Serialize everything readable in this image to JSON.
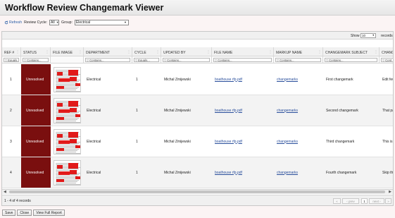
{
  "title": "Workflow Review Changemark Viewer",
  "toolbar": {
    "refresh_label": "Refresh",
    "review_cycle_label": "Review Cycle:",
    "review_cycle_value": "All",
    "group_label": "Group:",
    "group_value": "Electrical"
  },
  "pager_top": {
    "show_label": "Show",
    "show_value": "10",
    "records_label": "records"
  },
  "columns": [
    {
      "label": "REF #",
      "filter": "Equals..."
    },
    {
      "label": "STATUS",
      "filter": "Contains..."
    },
    {
      "label": "FILE IMAGE",
      "filter": ""
    },
    {
      "label": "DEPARTMENT",
      "filter": "Contains..."
    },
    {
      "label": "CYCLE",
      "filter": "Equals..."
    },
    {
      "label": "UPDATED BY",
      "filter": "Contains..."
    },
    {
      "label": "FILE NAME",
      "filter": "Contains..."
    },
    {
      "label": "MARKUP NAME",
      "filter": "Contains..."
    },
    {
      "label": "CHANGEMARK SUBJECT",
      "filter": "Contains..."
    },
    {
      "label": "CHANGE",
      "filter": "Cont"
    }
  ],
  "rows": [
    {
      "ref": "1",
      "status": "Unresolved",
      "department": "Electrical",
      "cycle": "1",
      "updated_by": "Michal Zmijewski",
      "file_name": "boathouse rfp.pdf",
      "markup_name": "changemarks",
      "subject": "First changemark",
      "change": "Edit few"
    },
    {
      "ref": "2",
      "status": "Unresolved",
      "department": "Electrical",
      "cycle": "1",
      "updated_by": "Michal Zmijewski",
      "file_name": "boathouse rfp.pdf",
      "markup_name": "changemarks",
      "subject": "Second changemark",
      "change": "That par"
    },
    {
      "ref": "3",
      "status": "Unresolved",
      "department": "Electrical",
      "cycle": "1",
      "updated_by": "Michal Zmijewski",
      "file_name": "boathouse rfp.pdf",
      "markup_name": "changemarks",
      "subject": "Third changemark",
      "change": "This is o"
    },
    {
      "ref": "4",
      "status": "Unresolved",
      "department": "Electrical",
      "cycle": "1",
      "updated_by": "Michal Zmijewski",
      "file_name": "boathouse rfp.pdf",
      "markup_name": "changemarks",
      "subject": "Fourth changemark",
      "change": "Skip this"
    }
  ],
  "footer": {
    "count_text": "1 - 4 of 4 records",
    "first_label": "«",
    "prev_label": "‹ prev",
    "page_label": "1",
    "next_label": "next ›",
    "last_label": "»"
  },
  "actions": {
    "save_label": "Save",
    "close_label": "Close",
    "report_label": "View Full Report"
  },
  "colors": {
    "status_unresolved": "#7a0f0f",
    "link": "#2a4f9c",
    "markup_red": "#e11a1a"
  },
  "icons": {
    "refresh": "refresh-icon",
    "filter": "filter-icon",
    "column_menu": "column-menu-icon"
  }
}
